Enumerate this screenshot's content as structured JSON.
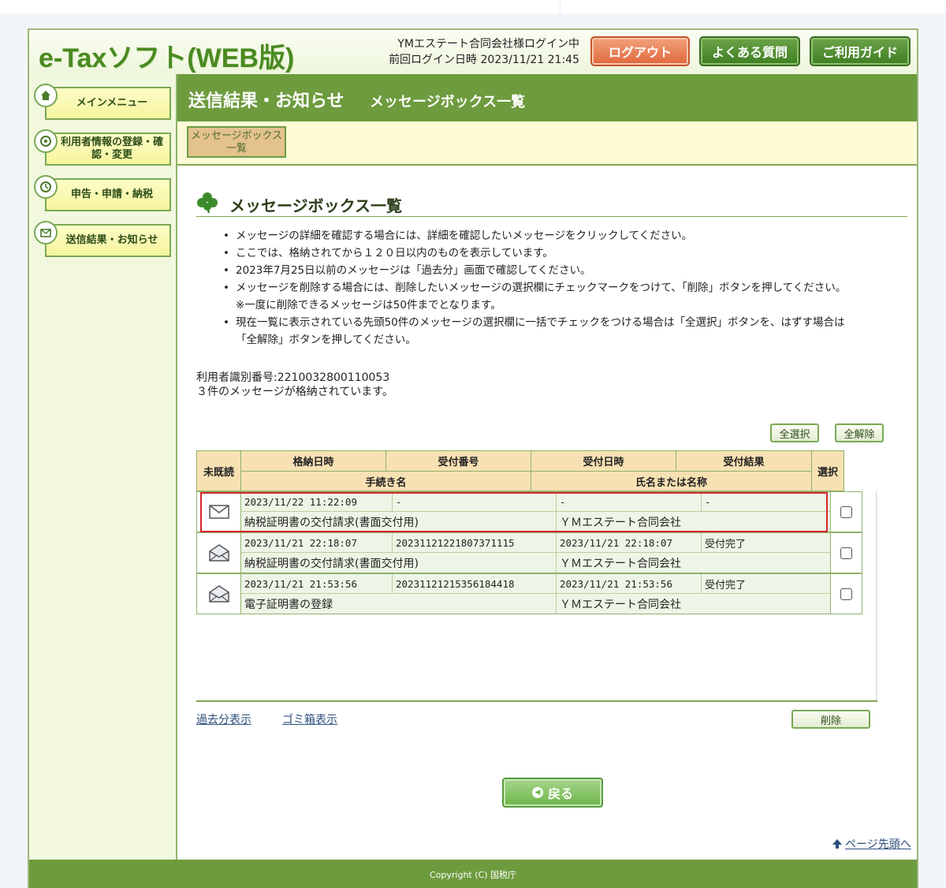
{
  "header": {
    "logo": "e-Taxソフト(WEB版)",
    "login_user": "YMエステート合同会社様ログイン中",
    "last_login": "前回ログイン日時 2023/11/21 21:45",
    "logout_label": "ログアウト",
    "faq_label": "よくある質問",
    "guide_label": "ご利用ガイド"
  },
  "sidebar": {
    "items": [
      {
        "label": "メインメニュー",
        "icon": "home-icon"
      },
      {
        "label": "利用者情報の登録・確認・変更",
        "icon": "user-settings-icon"
      },
      {
        "label": "申告・申請・納税",
        "icon": "clock-icon"
      },
      {
        "label": "送信結果・お知らせ",
        "icon": "mail-icon"
      }
    ]
  },
  "main": {
    "title": "送信結果・お知らせ",
    "subtitle": "メッセージボックス一覧",
    "tab_label": "メッセージボックス一覧",
    "section_title": "メッセージボックス一覧",
    "notes": [
      "メッセージの詳細を確認する場合には、詳細を確認したいメッセージをクリックしてください。",
      "ここでは、格納されてから１２０日以内のものを表示しています。",
      "2023年7月25日以前のメッセージは「過去分」画面で確認してください。",
      "メッセージを削除する場合には、削除したいメッセージの選択欄にチェックマークをつけて、「削除」ボタンを押してください。",
      "※一度に削除できるメッセージは50件までとなります。",
      "現在一覧に表示されている先頭50件のメッセージの選択欄に一括でチェックをつける場合は「全選択」ボタンを、はずす場合は",
      "「全解除」ボタンを押してください。"
    ],
    "user_id": "利用者識別番号:2210032800110053",
    "message_count": "３件のメッセージが格納されています。",
    "select_all_label": "全選択",
    "deselect_all_label": "全解除",
    "delete_label": "削除",
    "past_link": "過去分表示",
    "trash_link": "ゴミ箱表示",
    "back_label": "戻る",
    "page_top_label": "ページ先頭へ"
  },
  "table": {
    "headers": {
      "unread": "未既読",
      "stored_at": "格納日時",
      "receipt_no": "受付番号",
      "received_at": "受付日時",
      "result": "受付結果",
      "procedure": "手続き名",
      "name": "氏名または名称",
      "select": "選択"
    },
    "rows": [
      {
        "stored_at": "2023/11/22 11:22:09",
        "receipt_no": "-",
        "received_at": "-",
        "result": "-",
        "procedure": "納税証明書の交付請求(書面交付用)",
        "name": "ＹＭエステート合同会社",
        "read": false
      },
      {
        "stored_at": "2023/11/21 22:18:07",
        "receipt_no": "20231121221807371115",
        "received_at": "2023/11/21 22:18:07",
        "result": "受付完了",
        "procedure": "納税証明書の交付請求(書面交付用)",
        "name": "ＹＭエステート合同会社",
        "read": true
      },
      {
        "stored_at": "2023/11/21 21:53:56",
        "receipt_no": "20231121215356184418",
        "received_at": "2023/11/21 21:53:56",
        "result": "受付完了",
        "procedure": "電子証明書の登録",
        "name": "ＹＭエステート合同会社",
        "read": true
      }
    ]
  },
  "footer": {
    "copyright": "Copyright (C) 国税庁"
  },
  "colors": {
    "brand_green": "#6e9b3e",
    "highlight_red": "#d6242a",
    "logout_orange": "#e0683b"
  }
}
